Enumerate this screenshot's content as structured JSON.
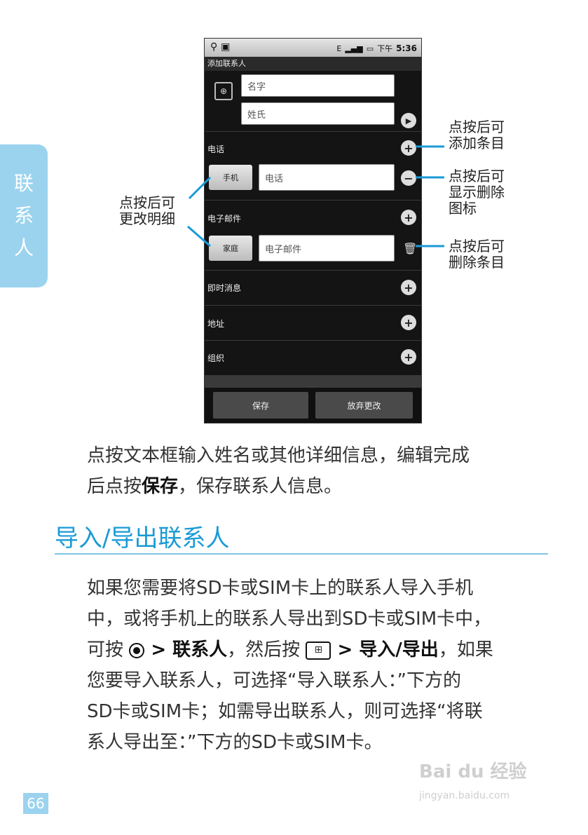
{
  "side_tab": [
    "联",
    "系",
    "人"
  ],
  "phone": {
    "status": {
      "left_icons": "⚲ ▣",
      "network": "E",
      "ampm": "下午",
      "time": "5:36"
    },
    "title": "添加联系人",
    "name_placeholder": "名字",
    "surname_placeholder": "姓氏",
    "sections": {
      "phone": "电话",
      "email": "电子邮件",
      "im": "即时消息",
      "address": "地址",
      "org": "组织"
    },
    "phone_type": "手机",
    "phone_placeholder": "电话",
    "email_type": "家庭",
    "email_placeholder": "电子邮件",
    "save": "保存",
    "discard": "放弃更改"
  },
  "callouts": {
    "add": [
      "点按后可",
      "添加条目"
    ],
    "show_delete": [
      "点按后可",
      "显示删除",
      "图标"
    ],
    "change": [
      "点按后可",
      "更改明细"
    ],
    "delete": [
      "点按后可",
      "删除条目"
    ]
  },
  "para1": {
    "line1": "点按文本框输入姓名或其他详细信息，编辑完成",
    "line2_pre": "后点按",
    "line2_bold": "保存",
    "line2_post": "，保存联系人信息。"
  },
  "heading": "导入/导出联系人",
  "para2": {
    "line1": "如果您需要将SD卡或SIM卡上的联系人导入手机",
    "line2": "中，或将手机上的联系人导出到SD卡或SIM卡中，",
    "line3_pre": "可按 ",
    "line3_b1": " > 联系人",
    "line3_mid": "，然后按 ",
    "line3_b2": " > 导入/导出",
    "line3_post": "，如果",
    "line4": "您要导入联系人，可选择“导入联系人：”下方的",
    "line5": "SD卡或SIM卡；如需导出联系人，则可选择“将联",
    "line6": "系人导出至：”下方的SD卡或SIM卡。"
  },
  "page_number": "66",
  "watermark": {
    "main": "Bai du 经验",
    "sub": "jingyan.baidu.com"
  }
}
